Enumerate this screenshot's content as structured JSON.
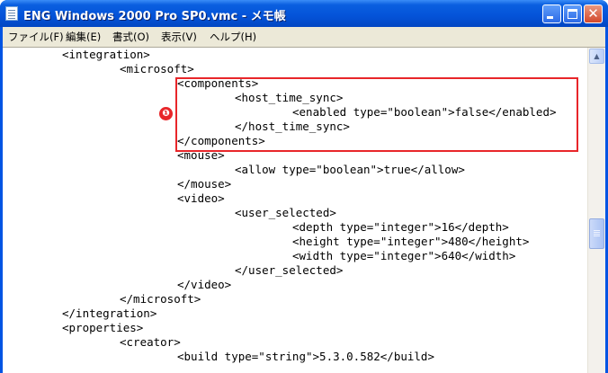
{
  "window": {
    "title": "ENG Windows 2000 Pro SP0.vmc - メモ帳",
    "controls": {
      "minimize_icon": "minimize-icon",
      "maximize_icon": "maximize-icon",
      "close_symbol": "✕"
    }
  },
  "menu": {
    "items": [
      {
        "label": "ファイル(F)"
      },
      {
        "label": "編集(E)"
      },
      {
        "label": "書式(O)"
      },
      {
        "label": "表示(V)"
      },
      {
        "label": "ヘルプ(H)"
      }
    ]
  },
  "editor": {
    "lines": [
      "<integration>",
      "<microsoft>",
      "<components>",
      "<host_time_sync>",
      "<enabled type=\"boolean\">false</enabled>",
      "</host_time_sync>",
      "</components>",
      "<mouse>",
      "<allow type=\"boolean\">true</allow>",
      "</mouse>",
      "<video>",
      "<user_selected>",
      "<depth type=\"integer\">16</depth>",
      "<height type=\"integer\">480</height>",
      "<width type=\"integer\">640</width>",
      "</user_selected>",
      "</video>",
      "</microsoft>",
      "</integration>",
      "<properties>",
      "<creator>",
      "<build type=\"string\">5.3.0.582</build>"
    ]
  },
  "annotation": {
    "badge": "❶",
    "highlight_color": "#e8262a"
  },
  "colors": {
    "titlebar": "#0453d8",
    "menubar": "#ece9d8",
    "close_button": "#d3482b"
  }
}
